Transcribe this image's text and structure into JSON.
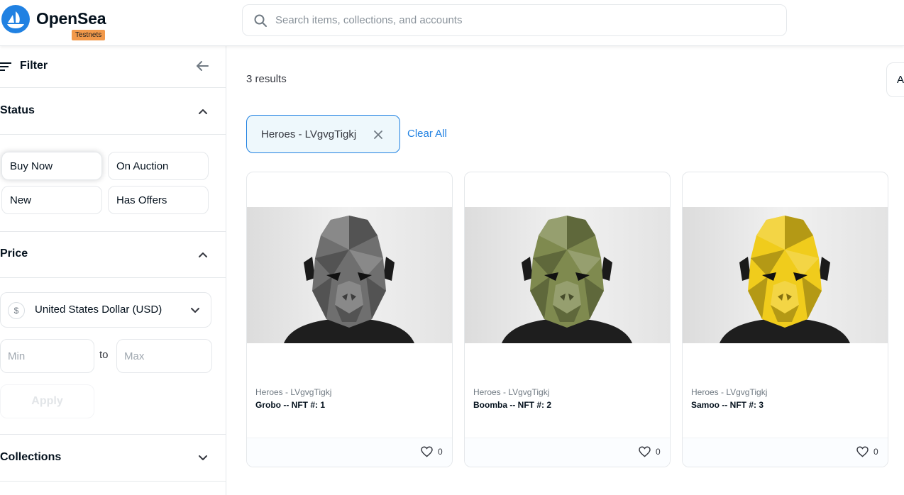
{
  "header": {
    "brand": "OpenSea",
    "badge": "Testnets",
    "brand_color": "#2081e2",
    "badge_color": "#f2994a",
    "search_placeholder": "Search items, collections, and accounts"
  },
  "sidebar": {
    "filter_title": "Filter",
    "status": {
      "title": "Status",
      "options": [
        "Buy Now",
        "On Auction",
        "New",
        "Has Offers"
      ],
      "selected": "Buy Now"
    },
    "price": {
      "title": "Price",
      "currency": "United States Dollar (USD)",
      "currency_symbol": "$",
      "min_placeholder": "Min",
      "max_placeholder": "Max",
      "to_label": "to",
      "apply_label": "Apply"
    },
    "collections": {
      "title": "Collections"
    }
  },
  "main": {
    "results_text": "3 results",
    "sort_label_partial": "A",
    "active_filter": "Heroes - LVgvgTigkj",
    "clear_all": "Clear All",
    "accent_color": "#2081e2",
    "items": [
      {
        "collection": "Heroes - LVgvgTigkj",
        "name": "Grobo -- NFT #: 1",
        "likes": "0",
        "mask_color": "#6f6f6f"
      },
      {
        "collection": "Heroes - LVgvgTigkj",
        "name": "Boomba -- NFT #: 2",
        "likes": "0",
        "mask_color": "#7f8a4f"
      },
      {
        "collection": "Heroes - LVgvgTigkj",
        "name": "Samoo -- NFT #: 3",
        "likes": "0",
        "mask_color": "#f0cc1c"
      }
    ]
  }
}
